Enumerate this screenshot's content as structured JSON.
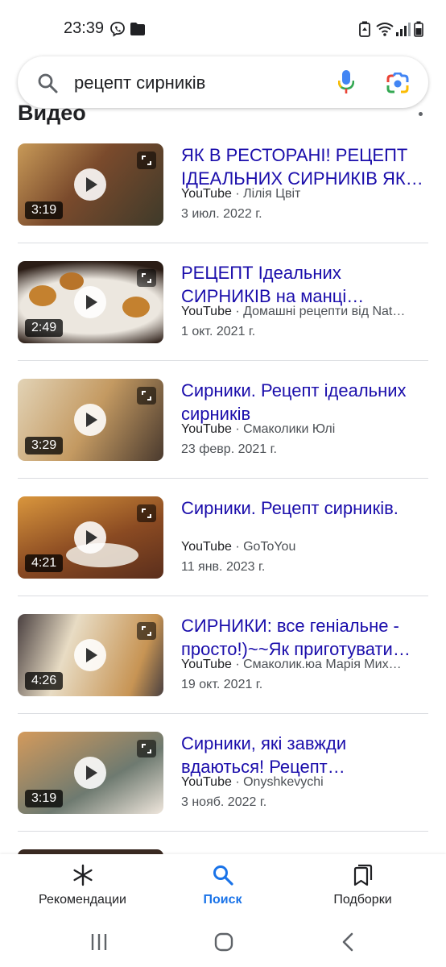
{
  "status_bar": {
    "time": "23:39"
  },
  "search": {
    "query": "рецепт сирників"
  },
  "section": {
    "title": "Видео"
  },
  "results": [
    {
      "title": "ЯК В РЕСТОРАНІ! РЕЦЕПТ ІДЕАЛЬНИХ СИРНИКІВ ЯК…",
      "source": "YouTube",
      "channel": "Лілія Цвіт",
      "date": "3 июл. 2022 г.",
      "duration": "3:19",
      "thumb_colors": [
        "#7a4a2c",
        "#c89a58",
        "#3e3a2a"
      ]
    },
    {
      "title": "РЕЦЕПТ Ідеальних СИРНИКІВ на манці…",
      "source": "YouTube",
      "channel": "Домашні рецепти від Nat…",
      "date": "1 окт. 2021 г.",
      "duration": "2:49",
      "thumb_colors": [
        "#2b1d16",
        "#ece7df",
        "#c4812f"
      ]
    },
    {
      "title": "Сирники. Рецепт ідеальних сирників",
      "source": "YouTube",
      "channel": "Смаколики Юлі",
      "date": "23 февр. 2021 г.",
      "duration": "3:29",
      "thumb_colors": [
        "#4a3a2e",
        "#e2d3b6",
        "#c49a62"
      ]
    },
    {
      "title": "Сирники. Рецепт сирників.",
      "source": "YouTube",
      "channel": "GoToYou",
      "date": "11 янв. 2023 г.",
      "duration": "4:21",
      "thumb_colors": [
        "#5a2e1c",
        "#d9963d",
        "#f2eee6"
      ]
    },
    {
      "title": "СИРНИКИ: все геніальне - просто!)~~Як приготувати…",
      "source": "YouTube",
      "channel": "Смаколик.юа Марія Мих…",
      "date": "19 окт. 2021 г.",
      "duration": "4:26",
      "thumb_colors": [
        "#e8dcc4",
        "#c79454",
        "#4a4040"
      ]
    },
    {
      "title": "Сирники, які завжди вдаються! Рецепт…",
      "source": "YouTube",
      "channel": "Onyshkevychi",
      "date": "3 нояб. 2022 г.",
      "duration": "3:19",
      "thumb_colors": [
        "#6e7a70",
        "#d39a5c",
        "#efe6dc"
      ]
    }
  ],
  "bottom_nav": [
    {
      "label": "Рекомендации",
      "icon": "asterisk-icon",
      "active": false
    },
    {
      "label": "Поиск",
      "icon": "search-icon",
      "active": true
    },
    {
      "label": "Подборки",
      "icon": "collections-icon",
      "active": false
    }
  ],
  "colors": {
    "link": "#1a0dab",
    "accent": "#1a73e8",
    "divider": "#dadce0"
  }
}
